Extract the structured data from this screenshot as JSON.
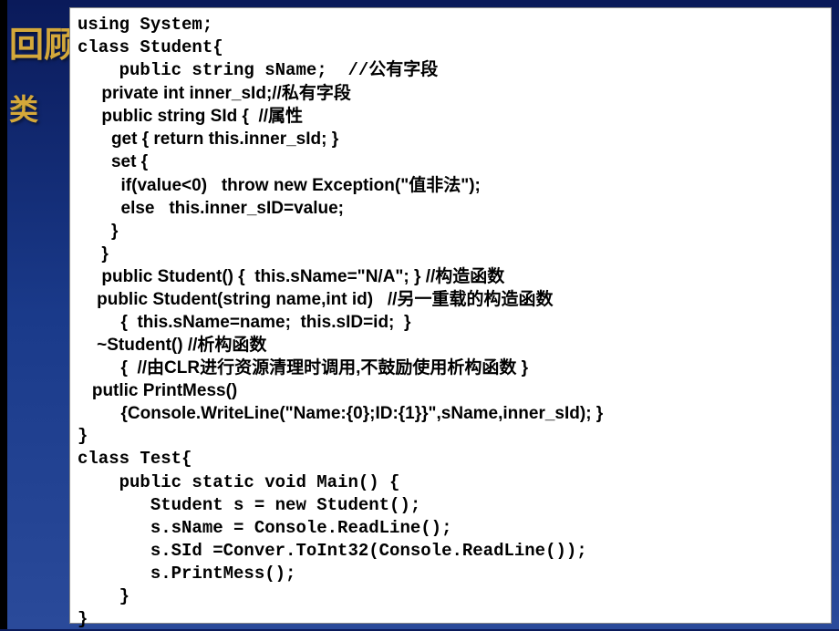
{
  "background": {
    "title1": "回顾",
    "bullet": "➢",
    "title2": "类"
  },
  "code": {
    "lines": [
      {
        "text": "using System;",
        "class": ""
      },
      {
        "text": "class Student{",
        "class": ""
      },
      {
        "text": "    public string sName;  //公有字段",
        "class": ""
      },
      {
        "text": "     private int inner_sId;//私有字段",
        "class": "arial-font"
      },
      {
        "text": "     public string SId {  //属性",
        "class": "arial-font"
      },
      {
        "text": "       get { return this.inner_sId; }",
        "class": "arial-font"
      },
      {
        "text": "       set {",
        "class": "arial-font"
      },
      {
        "text": "         if(value<0)   throw new Exception(\"值非法\");",
        "class": "arial-font"
      },
      {
        "text": "         else   this.inner_sID=value;",
        "class": "arial-font"
      },
      {
        "text": "       }",
        "class": "arial-font"
      },
      {
        "text": "     }",
        "class": "arial-font"
      },
      {
        "text": "     public Student() {  this.sName=\"N/A\"; } //构造函数",
        "class": "arial-font"
      },
      {
        "text": "    public Student(string name,int id)   //另一重载的构造函数",
        "class": "arial-font"
      },
      {
        "text": "         {  this.sName=name;  this.sID=id;  }",
        "class": "arial-font"
      },
      {
        "text": "    ~Student() //析构函数",
        "class": "arial-font"
      },
      {
        "text": "         {  //由CLR进行资源清理时调用,不鼓励使用析构函数 }",
        "class": "arial-font"
      },
      {
        "text": "   putlic PrintMess()",
        "class": "arial-font"
      },
      {
        "text": "         {Console.WriteLine(\"Name:{0};ID:{1}}\",sName,inner_sId); }",
        "class": "arial-font"
      },
      {
        "text": "}",
        "class": ""
      },
      {
        "text": "class Test{",
        "class": ""
      },
      {
        "text": "    public static void Main() {",
        "class": ""
      },
      {
        "text": "       Student s = new Student();",
        "class": ""
      },
      {
        "text": "       s.sName = Console.ReadLine();",
        "class": ""
      },
      {
        "text": "       s.SId =Conver.ToInt32(Console.ReadLine());",
        "class": ""
      },
      {
        "text": "       s.PrintMess();",
        "class": ""
      },
      {
        "text": "    }",
        "class": ""
      },
      {
        "text": "}",
        "class": ""
      }
    ]
  }
}
